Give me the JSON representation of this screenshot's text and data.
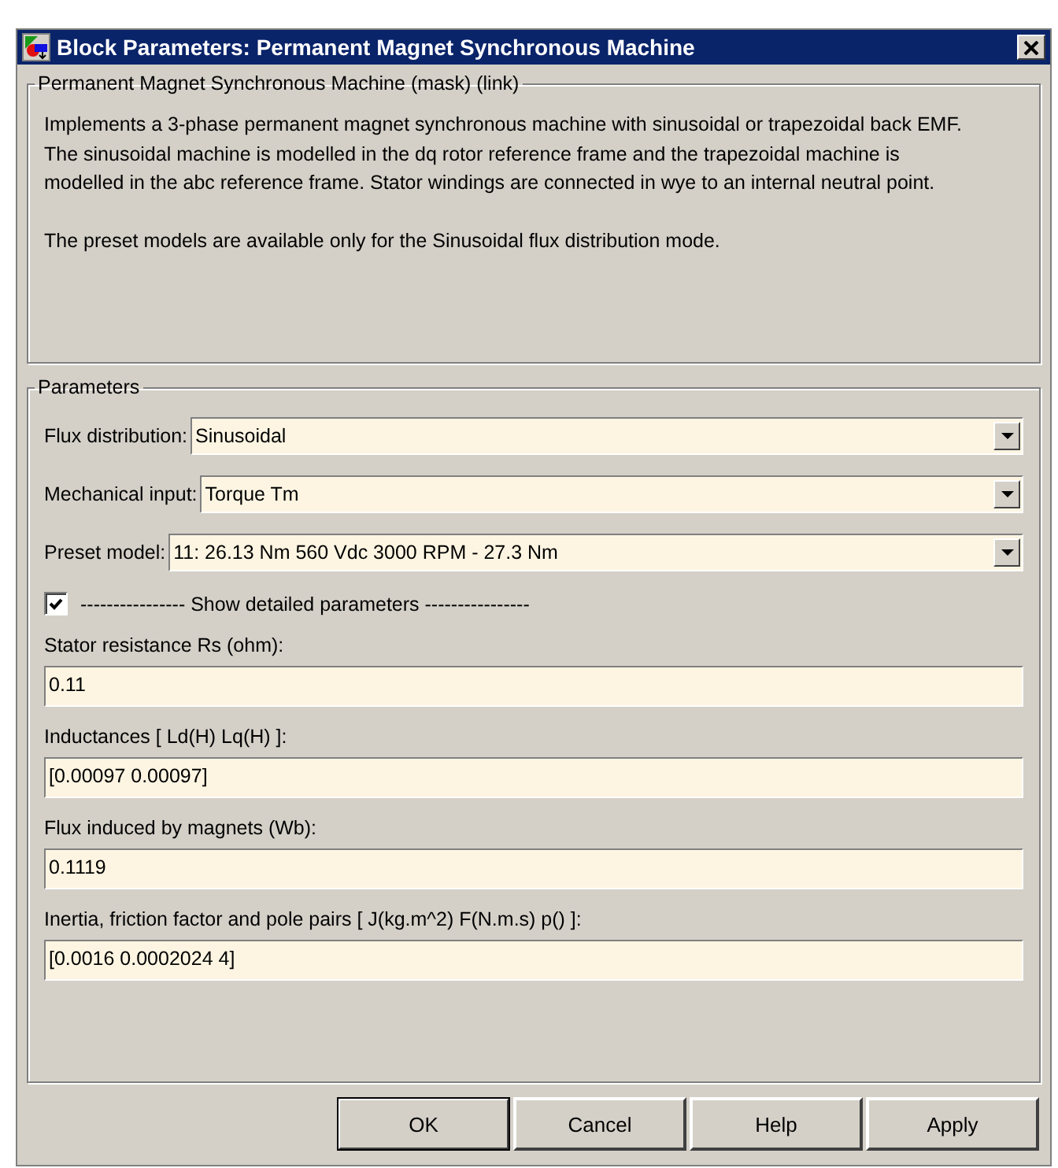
{
  "window": {
    "title": "Block Parameters: Permanent Magnet Synchronous Machine"
  },
  "description": {
    "title": "Permanent Magnet Synchronous Machine (mask) (link)",
    "paragraphs": [
      "Implements a 3-phase permanent magnet synchronous machine with sinusoidal or trapezoidal back EMF. The sinusoidal machine is modelled in the dq rotor reference frame and the trapezoidal machine is modelled in the abc reference frame. Stator windings are connected in wye to an internal neutral point.",
      "The preset models are available only for the Sinusoidal flux distribution mode."
    ]
  },
  "parameters": {
    "title": "Parameters",
    "items": [
      {
        "kind": "dropdown",
        "label": "Flux distribution:",
        "value": "Sinusoidal"
      },
      {
        "kind": "dropdown",
        "label": "Mechanical input:",
        "value": "Torque Tm"
      },
      {
        "kind": "dropdown",
        "label": "Preset model:",
        "value": "11:  26.13 Nm 560 Vdc 3000 RPM - 27.3 Nm"
      },
      {
        "kind": "checkbox",
        "label": "---------------- Show detailed parameters ----------------",
        "checked": true
      },
      {
        "kind": "field",
        "label": "Stator resistance Rs (ohm):",
        "value": "0.11"
      },
      {
        "kind": "field",
        "label": "Inductances [ Ld(H) Lq(H) ]:",
        "value": "[0.00097 0.00097]"
      },
      {
        "kind": "field",
        "label": "Flux induced by magnets (Wb):",
        "value": "0.1119"
      },
      {
        "kind": "field",
        "label": "Inertia, friction factor and pole pairs [ J(kg.m^2)  F(N.m.s)  p() ]:",
        "value": "[0.0016 0.0002024 4]"
      }
    ]
  },
  "buttons": [
    {
      "label": "OK",
      "default": true
    },
    {
      "label": "Cancel",
      "default": false
    },
    {
      "label": "Help",
      "default": false
    },
    {
      "label": "Apply",
      "default": false
    }
  ]
}
